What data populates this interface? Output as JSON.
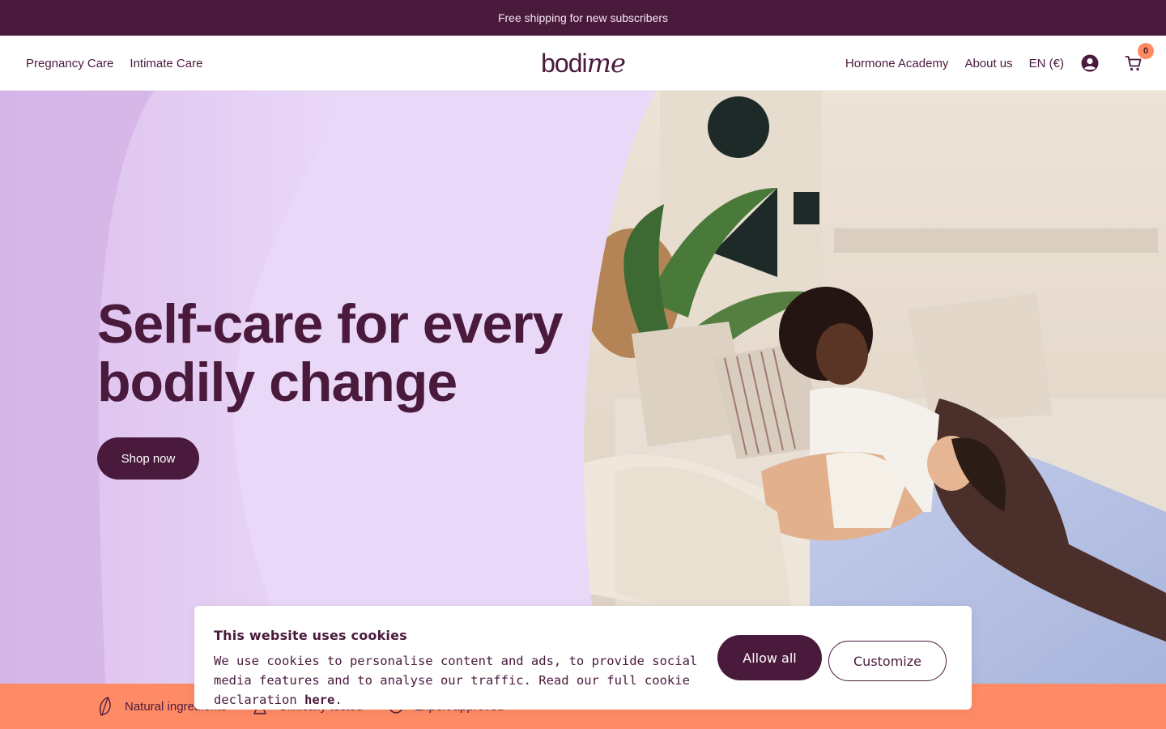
{
  "announcement": {
    "text": "Free shipping for new subscribers"
  },
  "header": {
    "nav_left": [
      {
        "label": "Pregnancy Care"
      },
      {
        "label": "Intimate Care"
      }
    ],
    "logo": {
      "part1": "bodi",
      "part2": "me"
    },
    "nav_right": [
      {
        "label": "Hormone Academy"
      },
      {
        "label": "About us"
      },
      {
        "label": "EN (€)"
      }
    ],
    "account_icon": "user-circle-icon",
    "cart_icon": "cart-icon",
    "cart_count": "0"
  },
  "hero": {
    "title_line1": "Self-care for every",
    "title_line2": "bodily change",
    "cta_label": "Shop now"
  },
  "usp_bar": {
    "items": [
      {
        "icon": "leaf-icon",
        "label": "Natural ingredients"
      },
      {
        "icon": "flask-icon",
        "label": "Clinically tested"
      },
      {
        "icon": "check-icon",
        "label": "Expert approved"
      }
    ]
  },
  "cookie_banner": {
    "title": "This website uses cookies",
    "text": "We use cookies to personalise content and ads, to provide social media features and to analyse our traffic. Read our full cookie declaration ",
    "link_label": "here",
    "text_end": ".",
    "allow_label": "Allow all",
    "customize_label": "Customize"
  },
  "colors": {
    "brand": "#4a1a3c",
    "hero_bg": "#e9d6f7",
    "accent": "#ff8b66",
    "badge": "#ff8b5e"
  }
}
